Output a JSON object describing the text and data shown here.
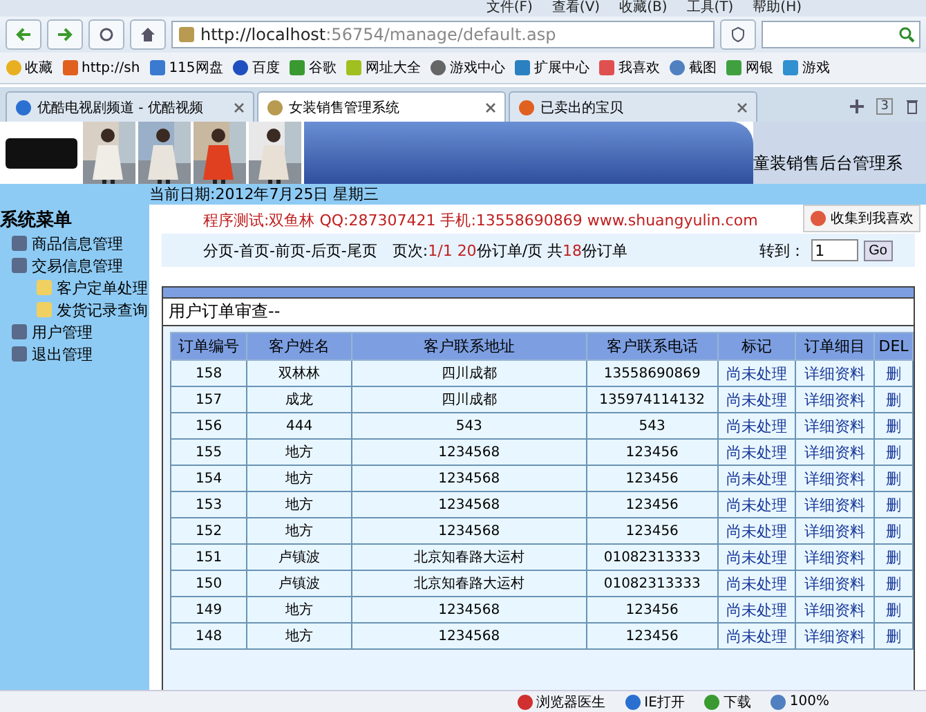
{
  "menu_bar": [
    "文件(F)",
    "查看(V)",
    "收藏(B)",
    "工具(T)",
    "帮助(H)"
  ],
  "address_bar": {
    "value_host": "http://localhost",
    "value_rest": ":56754/manage/default.asp"
  },
  "bookmarks": [
    "收藏",
    "http://sh",
    "115网盘",
    "百度",
    "谷歌",
    "网址大全",
    "游戏中心",
    "扩展中心",
    "我喜欢",
    "截图",
    "网银",
    "游戏"
  ],
  "tabs": [
    {
      "label": "优酷电视剧频道 - 优酷视频",
      "selected": false
    },
    {
      "label": "女装销售管理系统",
      "selected": true
    },
    {
      "label": "已卖出的宝贝",
      "selected": false
    }
  ],
  "tab_count": "3",
  "banner": {
    "title": "童装销售后台管理系"
  },
  "date_line": "当前日期:2012年7月25日  星期三",
  "sidebar": {
    "title": "系统菜单",
    "items": [
      {
        "label": "商品信息管理"
      },
      {
        "label": "交易信息管理",
        "children": [
          {
            "label": "客户定单处理"
          },
          {
            "label": "发货记录查询"
          }
        ]
      },
      {
        "label": "用户管理"
      },
      {
        "label": "退出管理"
      }
    ]
  },
  "collect_button": "收集到我喜欢",
  "notice": "程序测试:双鱼林 QQ:287307421 手机:13558690869 www.shuangyulin.com",
  "pager": {
    "links": "分页-首页-前页-后页-尾页",
    "page_label": "页次:",
    "page": "1/1",
    "per_page": "20",
    "per_page_label": "份订单/页",
    "total_label": "共",
    "total": "18",
    "total_unit": "份订单",
    "goto_label": "转到：",
    "goto_value": "1",
    "go_button": "Go"
  },
  "panel_title": "用户订单审查--",
  "table": {
    "columns": [
      "订单编号",
      "客户姓名",
      "客户联系地址",
      "客户联系电话",
      "标记",
      "订单细目",
      "DEL"
    ],
    "rows": [
      [
        "158",
        "双林林",
        "四川成都",
        "13558690869",
        "尚未处理",
        "详细资料",
        "删"
      ],
      [
        "157",
        "成龙",
        "四川成都",
        "135974114132",
        "尚未处理",
        "详细资料",
        "删"
      ],
      [
        "156",
        "444",
        "543",
        "543",
        "尚未处理",
        "详细资料",
        "删"
      ],
      [
        "155",
        "地方",
        "1234568",
        "123456",
        "尚未处理",
        "详细资料",
        "删"
      ],
      [
        "154",
        "地方",
        "1234568",
        "123456",
        "尚未处理",
        "详细资料",
        "删"
      ],
      [
        "153",
        "地方",
        "1234568",
        "123456",
        "尚未处理",
        "详细资料",
        "删"
      ],
      [
        "152",
        "地方",
        "1234568",
        "123456",
        "尚未处理",
        "详细资料",
        "删"
      ],
      [
        "151",
        "卢镇波",
        "北京知春路大运村",
        "01082313333",
        "尚未处理",
        "详细资料",
        "删"
      ],
      [
        "150",
        "卢镇波",
        "北京知春路大运村",
        "01082313333",
        "尚未处理",
        "详细资料",
        "删"
      ],
      [
        "149",
        "地方",
        "1234568",
        "123456",
        "尚未处理",
        "详细资料",
        "删"
      ],
      [
        "148",
        "地方",
        "1234568",
        "123456",
        "尚未处理",
        "详细资料",
        "删"
      ]
    ]
  },
  "status_bar": [
    "浏览器医生",
    "IE打开",
    "下载",
    "100%"
  ]
}
